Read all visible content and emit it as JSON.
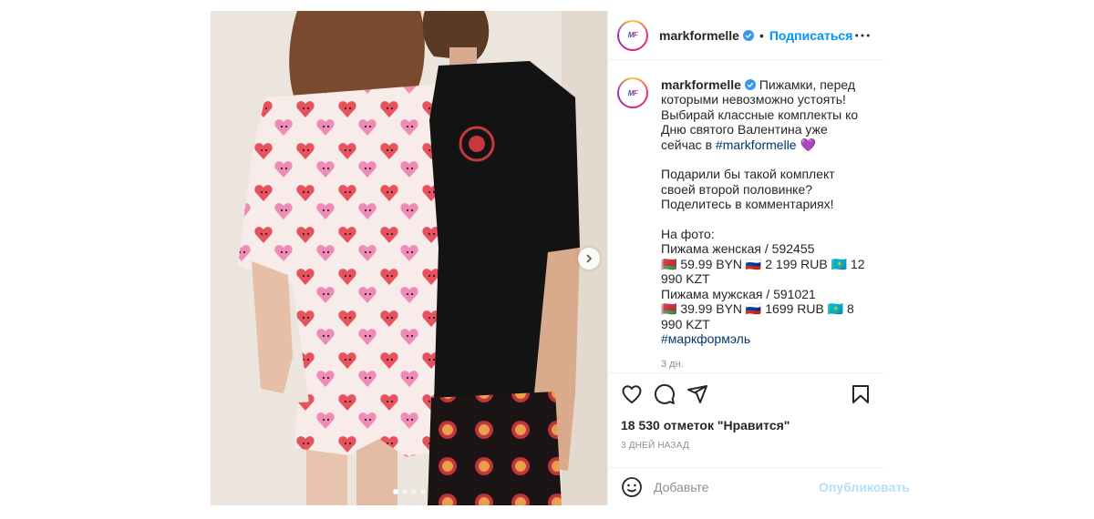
{
  "post": {
    "username": "markformelle",
    "separator": "•",
    "follow_label": "Подписаться",
    "avatar_logo": "MF",
    "caption": {
      "line1": "Пижамки, перед которыми невозможно устоять! Выбирай классные комплекты ко Дню святого Валентина уже сейчас в ",
      "hashtag1": "#markformelle",
      "heart": " 💜",
      "paragraph2": "\n\nПодарили бы такой комплект своей второй половинке? Поделитесь в комментариях!\n\nНа фото:\nПижама женская / 592455\n🇧🇾 59.99 BYN 🇷🇺 2 199 RUB 🇰🇿 12 990 KZT\nПижама мужская / 591021\n🇧🇾 39.99 BYN 🇷🇺 1699 RUB 🇰🇿 8 990 KZT\n",
      "hashtag2": "#маркформэль"
    },
    "caption_age": "3 дн.",
    "likes_text": "18 530 отметок \"Нравится\"",
    "date_text": "3 дней назад",
    "comment_placeholder": "Добавьте",
    "publish_label": "Опубликовать",
    "carousel": {
      "slides": 4,
      "active_index": 0
    }
  },
  "icons": {
    "verified": "verified-badge-icon",
    "more": "more-options-icon",
    "like": "heart-icon",
    "comment": "comment-icon",
    "share": "share-icon",
    "save": "bookmark-icon",
    "emoji": "emoji-icon",
    "next": "chevron-right-icon"
  },
  "colors": {
    "link_blue": "#0095f6",
    "hashtag": "#00376b",
    "muted": "#8e8e8e",
    "publish_disabled": "#b2dffc"
  }
}
